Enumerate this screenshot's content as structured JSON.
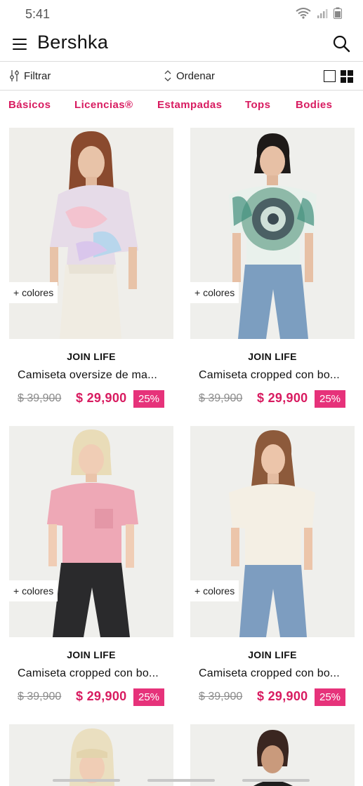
{
  "status_bar": {
    "time": "5:41"
  },
  "app": {
    "brand": "Bershka"
  },
  "toolbar": {
    "filter_label": "Filtrar",
    "sort_label": "Ordenar"
  },
  "categories": [
    "Básicos",
    "Licencias®",
    "Estampadas",
    "Tops",
    "Bodies"
  ],
  "colors": {
    "accent": "#d81b60",
    "badge": "#e6327a"
  },
  "products": [
    {
      "colors_tag": "+ colores",
      "label": "JOIN LIFE",
      "name": "Camiseta oversize de ma...",
      "old_price": "$ 39,900",
      "price": "$ 29,900",
      "discount": "25%"
    },
    {
      "colors_tag": "+ colores",
      "label": "JOIN LIFE",
      "name": "Camiseta cropped con bo...",
      "old_price": "$ 39,900",
      "price": "$ 29,900",
      "discount": "25%"
    },
    {
      "colors_tag": "+ colores",
      "label": "JOIN LIFE",
      "name": "Camiseta cropped con bo...",
      "old_price": "$ 39,900",
      "price": "$ 29,900",
      "discount": "25%"
    },
    {
      "colors_tag": "+ colores",
      "label": "JOIN LIFE",
      "name": "Camiseta cropped con bo...",
      "old_price": "$ 39,900",
      "price": "$ 29,900",
      "discount": "25%"
    }
  ]
}
